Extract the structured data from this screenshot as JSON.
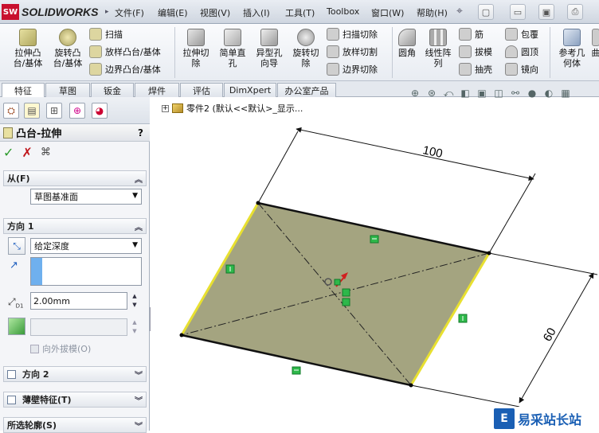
{
  "app": {
    "logo_badge": "SW",
    "logo_text": "SOLIDWORKS"
  },
  "menu": [
    "文件(F)",
    "编辑(E)",
    "视图(V)",
    "插入(I)",
    "工具(T)",
    "Toolbox",
    "窗口(W)",
    "帮助(H)"
  ],
  "quick_access": [
    "new-document-icon",
    "open-icon",
    "save-icon",
    "print-icon"
  ],
  "commands": {
    "extrude_boss": "拉伸凸\n台/基体",
    "revolve_boss": "旋转凸\n台/基体",
    "sweep": "扫描",
    "loft_boss": "放样凸台/基体",
    "boundary_boss": "边界凸台/基体",
    "extrude_cut": "拉伸切\n除",
    "simple_hole": "简单直\n孔",
    "hole_wizard": "异型孔\n向导",
    "revolve_cut": "旋转切\n除",
    "sweep_cut": "扫描切除",
    "loft_cut": "放样切割",
    "boundary_cut": "边界切除",
    "fillet": "圆角",
    "linear_pattern": "线性阵\n列",
    "rib": "筋",
    "draft": "拔模",
    "shell": "抽壳",
    "wrap": "包覆",
    "dome": "圆顶",
    "mirror": "镜向",
    "ref_geometry": "参考几\n何体",
    "curves": "曲"
  },
  "tabs": [
    "特征",
    "草图",
    "钣金",
    "焊件",
    "评估",
    "DimXpert",
    "办公室产品"
  ],
  "active_tab": 0,
  "tree_label": "零件2 (默认<<默认>_显示...",
  "property_manager": {
    "title": "凸台-拉伸",
    "help": "?",
    "from": {
      "header": "从(F)",
      "value": "草图基准面"
    },
    "direction1": {
      "header": "方向 1",
      "end_condition": "给定深度",
      "depth": "2.00mm",
      "depth_label": "D1",
      "draft_outward": "向外拔模(O)"
    },
    "direction2": {
      "header": "方向 2"
    },
    "thin_feature": {
      "header": "薄壁特征(T)"
    },
    "selected_contours": {
      "header": "所选轮廓(S)"
    }
  },
  "dimensions": {
    "width": "100",
    "depth": "60"
  },
  "colors": {
    "face": "#a4a480",
    "highlight_edge": "#e8e030",
    "accent": "#1a5fb4",
    "brand": "#c8102e"
  },
  "watermark": {
    "logo": "E",
    "text": "易采站长站"
  }
}
